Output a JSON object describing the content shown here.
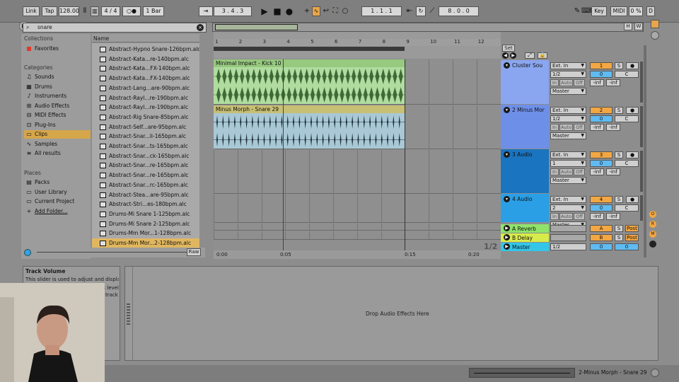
{
  "transport": {
    "link": "Link",
    "tap": "Tap",
    "tempo": "128.00",
    "time_signature": "4 / 4",
    "metronome": "○●",
    "quantize": "1 Bar",
    "position": "3 .  4 .  3",
    "loop_start": "1 .  1 .  1",
    "loop_length": "8 .  0 .  0",
    "key": "Key",
    "midi": "MIDI",
    "cpu": "0 %",
    "d_label": "D"
  },
  "browser": {
    "search_value": "snare",
    "collections_header": "Collections",
    "favorites": "Favorites",
    "categories_header": "Categories",
    "categories": [
      "Sounds",
      "Drums",
      "Instruments",
      "Audio Effects",
      "MIDI Effects",
      "Plug-Ins",
      "Clips",
      "Samples",
      "All results"
    ],
    "selected_category": "Clips",
    "places_header": "Places",
    "places": [
      "Packs",
      "User Library",
      "Current Project",
      "Add Folder..."
    ],
    "name_header": "Name",
    "files": [
      "Abstract-Hypno Snare-126bpm.alc",
      "Abstract-Kata...re-140bpm.alc",
      "Abstract-Kata...FX-140bpm.alc",
      "Abstract-Kata...FX-140bpm.alc",
      "Abstract-Lang...are-90bpm.alc",
      "Abstract-Rayl...re-190bpm.alc",
      "Abstract-Rayl...re-190bpm.alc",
      "Abstract-Rig Snare-85bpm.alc",
      "Abstract-Self...are-95bpm.alc",
      "Abstract-Snar...li-165bpm.alc",
      "Abstract-Snar...ts-165bpm.alc",
      "Abstract-Snar...ck-165bpm.alc",
      "Abstract-Snar...re-165bpm.alc",
      "Abstract-Snar...re-165bpm.alc",
      "Abstract-Snar...rc-165bpm.alc",
      "Abstract-Stea...are-95bpm.alc",
      "Abstract-Stri...es-180bpm.alc",
      "Drums-Mi Snare 1-125bpm.alc",
      "Drums-Mi Snare 2-125bpm.alc",
      "Drums-Mm Mor...1-128bpm.alc",
      "Drums-Mm Mor...2-128bpm.alc"
    ],
    "selected_file_index": 20,
    "raw_button": "Raw"
  },
  "arrangement": {
    "bar_numbers": [
      "1",
      "2",
      "3",
      "4",
      "5",
      "6",
      "7",
      "8",
      "9",
      "10",
      "11",
      "12"
    ],
    "time_ticks": [
      "0:00",
      "0:05",
      "0:15",
      "0:20"
    ],
    "page_indicator": "1/2",
    "set_button": "Set",
    "clips": [
      {
        "name": "Minimal Impact - Kick 10",
        "color": "#97c97f",
        "wave": "#3f6a37",
        "body": "#b0dca0"
      },
      {
        "name": "Minus Morph - Snare 29",
        "color": "#c7bf73",
        "wave": "#1e2f3a",
        "body": "#a9c8d6"
      }
    ]
  },
  "tracks": [
    {
      "name": "Cluster Sou",
      "color": "#8aa6f0",
      "input": "Ext. In",
      "channel": "1/2",
      "monitor": [
        "In",
        "Auto",
        "Off"
      ],
      "output": "Master",
      "number": "1",
      "volume": "0",
      "pan": "C",
      "sends": [
        "-inf",
        "-inf"
      ]
    },
    {
      "name": "2 Minus Mor",
      "color": "#6e8fe8",
      "input": "Ext. In",
      "channel": "1/2",
      "monitor": [
        "In",
        "Auto",
        "Off"
      ],
      "output": "Master",
      "number": "2",
      "volume": "0",
      "pan": "C",
      "sends": [
        "-inf",
        "-inf"
      ]
    },
    {
      "name": "3 Audio",
      "color": "#1a74bf",
      "input": "Ext. In",
      "channel": "1",
      "monitor": [
        "In",
        "Auto",
        "Off"
      ],
      "output": "Master",
      "number": "3",
      "volume": "0",
      "pan": "C",
      "sends": [
        "-inf",
        "-inf"
      ]
    },
    {
      "name": "4 Audio",
      "color": "#2a9fe6",
      "input": "Ext. In",
      "channel": "2",
      "monitor": [
        "In",
        "Auto",
        "Off"
      ],
      "output": "Master",
      "number": "4",
      "volume": "0",
      "pan": "C",
      "sends": [
        "-inf",
        "-inf"
      ]
    }
  ],
  "returns": [
    {
      "name": "A Reverb",
      "color": "#8fe36a",
      "letter": "A",
      "post": "Post"
    },
    {
      "name": "B Delay",
      "color": "#d7ec4a",
      "letter": "B",
      "post": "Post"
    }
  ],
  "master": {
    "name": "Master",
    "color": "#34c6e9",
    "channel": "1/2",
    "volume": "0",
    "pan": "0"
  },
  "solo_label": "S",
  "info": {
    "title": "Track Volume",
    "body_line1": "This slider is used to adjust and display",
    "body_line2": "k level",
    "body_line3": "track"
  },
  "device_panel": {
    "drop_text": "Drop Audio Effects Here"
  },
  "status": {
    "clip_name": "2-Minus Morph - Snare 29"
  }
}
